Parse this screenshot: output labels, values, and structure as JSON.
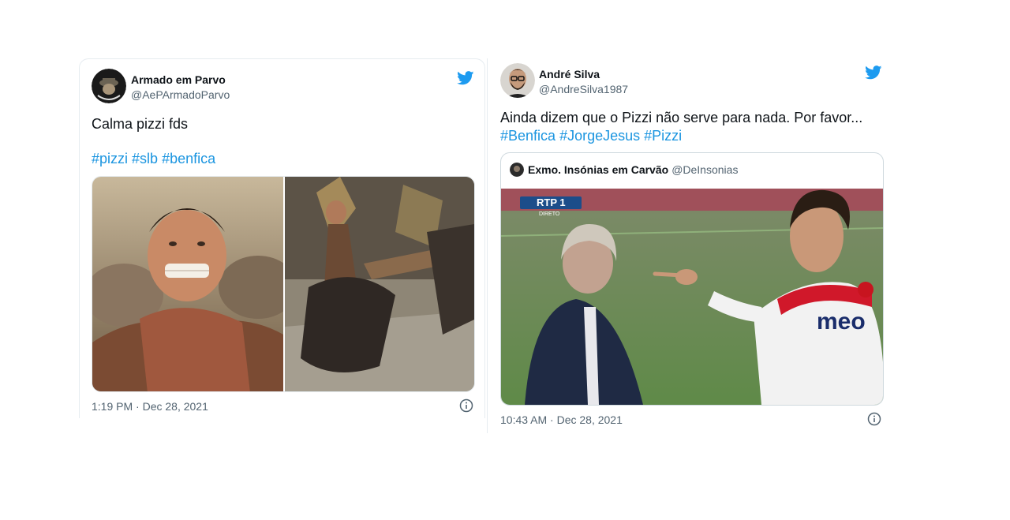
{
  "tweets": [
    {
      "author_name": "Armado em Parvo",
      "author_handle": "@AePArmadoParvo",
      "text": "Calma pizzi fds",
      "hashtags": [
        "#pizzi",
        "#slb",
        "#benfica"
      ],
      "timestamp": "1:19 PM · Dec 28, 2021",
      "bird_icon": "twitter-bird-icon",
      "info_icon": "info-icon"
    },
    {
      "author_name": "André Silva",
      "author_handle": "@AndreSilva1987",
      "text": "Ainda dizem que o Pizzi não serve para nada. Por favor...",
      "hashtags": [
        "#Benfica",
        "#JorgeJesus",
        "#Pizzi"
      ],
      "timestamp": "10:43 AM · Dec 28, 2021",
      "bird_icon": "twitter-bird-icon",
      "info_icon": "info-icon",
      "quote": {
        "author_name": "Exmo. Insónias em Carvão",
        "author_handle": "@DeInsonias",
        "media_overlay": {
          "channel": "RTP 1",
          "live": "DIRETO",
          "shirt_sponsor": "meo"
        }
      }
    }
  ],
  "colors": {
    "link": "#1b95e0",
    "twitter_blue": "#1d9bf0",
    "muted": "#536471",
    "border": "#e6ecf0"
  }
}
